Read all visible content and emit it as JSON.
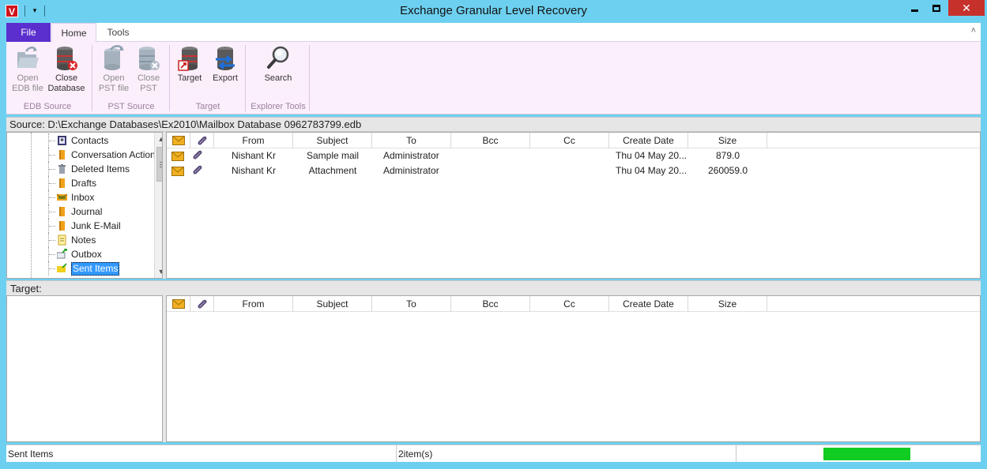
{
  "app": {
    "title": "Exchange Granular Level Recovery",
    "icon_letter": "V",
    "qat_menu_glyph": "▾"
  },
  "window_controls": {
    "close_glyph": "✕"
  },
  "ribbon": {
    "tabs": [
      {
        "label": "File"
      },
      {
        "label": "Home"
      },
      {
        "label": "Tools"
      }
    ],
    "collapse_glyph": "˄",
    "groups": {
      "edb_source": {
        "label": "EDB Source",
        "buttons": [
          {
            "label": "Open\nEDB file",
            "enabled": false
          },
          {
            "label": "Close\nDatabase",
            "enabled": true
          }
        ]
      },
      "pst_source": {
        "label": "PST Source",
        "buttons": [
          {
            "label": "Open\nPST file",
            "enabled": false
          },
          {
            "label": "Close\nPST",
            "enabled": false
          }
        ]
      },
      "target": {
        "label": "Target",
        "buttons": [
          {
            "label": "Target",
            "enabled": true
          },
          {
            "label": "Export",
            "enabled": true
          }
        ]
      },
      "explorer_tools": {
        "label": "Explorer Tools",
        "buttons": [
          {
            "label": "Search",
            "enabled": true
          }
        ]
      }
    }
  },
  "source": {
    "label": "Source: D:\\Exchange Databases\\Ex2010\\Mailbox Database 0962783799.edb"
  },
  "folder_tree": {
    "items": [
      {
        "label": "Contacts",
        "icon": "contacts-icon"
      },
      {
        "label": "Conversation Action Settings",
        "icon": "folder-icon"
      },
      {
        "label": "Deleted Items",
        "icon": "trash-icon"
      },
      {
        "label": "Drafts",
        "icon": "folder-icon"
      },
      {
        "label": "Inbox",
        "icon": "inbox-icon"
      },
      {
        "label": "Journal",
        "icon": "folder-icon"
      },
      {
        "label": "Junk E-Mail",
        "icon": "folder-icon"
      },
      {
        "label": "Notes",
        "icon": "notes-icon"
      },
      {
        "label": "Outbox",
        "icon": "outbox-icon"
      },
      {
        "label": "Sent Items",
        "icon": "sent-items-icon",
        "selected": true
      }
    ]
  },
  "mail_grid": {
    "columns": [
      "From",
      "Subject",
      "To",
      "Bcc",
      "Cc",
      "Create Date",
      "Size"
    ],
    "rows": [
      {
        "from": "Nishant Kr",
        "subject": "Sample mail",
        "to": "Administrator",
        "bcc": "",
        "cc": "",
        "create_date": "Thu 04 May 20...",
        "size": "879.0"
      },
      {
        "from": "Nishant Kr",
        "subject": "Attachment",
        "to": "Administrator",
        "bcc": "",
        "cc": "",
        "create_date": "Thu 04 May 20...",
        "size": "260059.0"
      }
    ]
  },
  "target": {
    "label": "Target:",
    "columns": [
      "From",
      "Subject",
      "To",
      "Bcc",
      "Cc",
      "Create Date",
      "Size"
    ]
  },
  "status": {
    "folder": "Sent Items",
    "count": "2item(s)",
    "progress": 1.0,
    "progress_color": "#11cc22"
  }
}
